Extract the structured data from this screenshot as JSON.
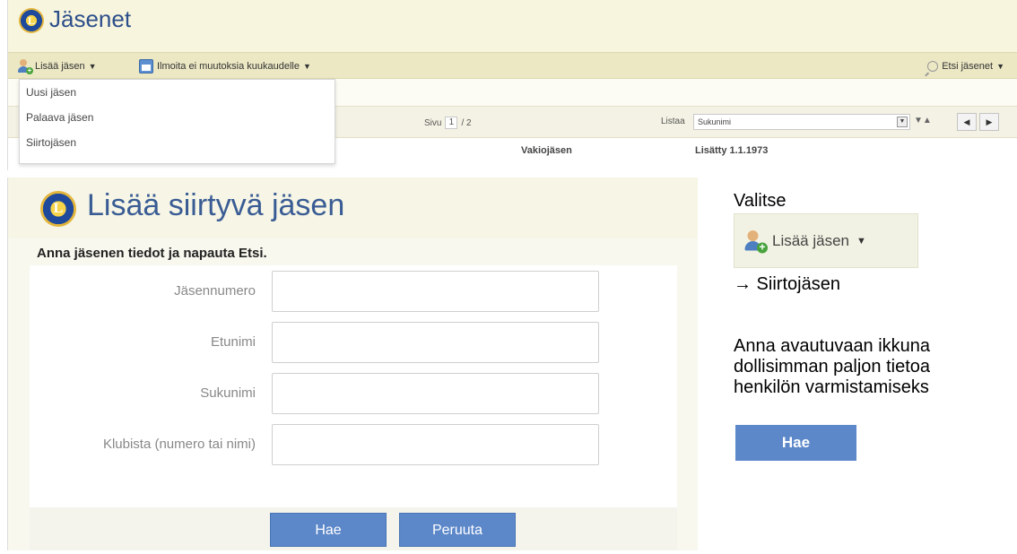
{
  "jasenet_screen": {
    "title": "Jäsenet",
    "toolbar": {
      "add_member_label": "Lisää jäsen",
      "report_no_changes_label": "Ilmoita ei muutoksia kuukaudelle",
      "search_members_label": "Etsi jäsenet"
    },
    "add_member_menu": [
      "Uusi jäsen",
      "Palaava jäsen",
      "Siirtojäsen"
    ],
    "pager": {
      "label": "Sivu",
      "current_page": "1",
      "total": "/ 2"
    },
    "sort": {
      "label": "Listaa",
      "selected": "Sukunimi"
    },
    "table_headers": [
      "Vakiojäsen",
      "Lisätty 1.1.1973"
    ]
  },
  "transfer_dialog": {
    "title": "Lisää siirtyvä jäsen",
    "instruction": "Anna jäsenen tiedot ja napauta Etsi.",
    "fields": [
      {
        "label": "Jäsennumero",
        "value": ""
      },
      {
        "label": "Etunimi",
        "value": ""
      },
      {
        "label": "Sukunimi",
        "value": ""
      },
      {
        "label": "Klubista (numero tai nimi)",
        "value": ""
      }
    ],
    "search_button": "Hae",
    "cancel_button": "Peruuta"
  },
  "instructions": {
    "choose": "Valitse",
    "example_button_label": "Lisää jäsen",
    "transfer_step": "→ Siirtojäsen",
    "line1": "Anna avautuvaan ikkuna",
    "line2": "dollisimman paljon tietoa",
    "line3": "henkilön varmistamiseks",
    "search_button_example": "Hae"
  }
}
